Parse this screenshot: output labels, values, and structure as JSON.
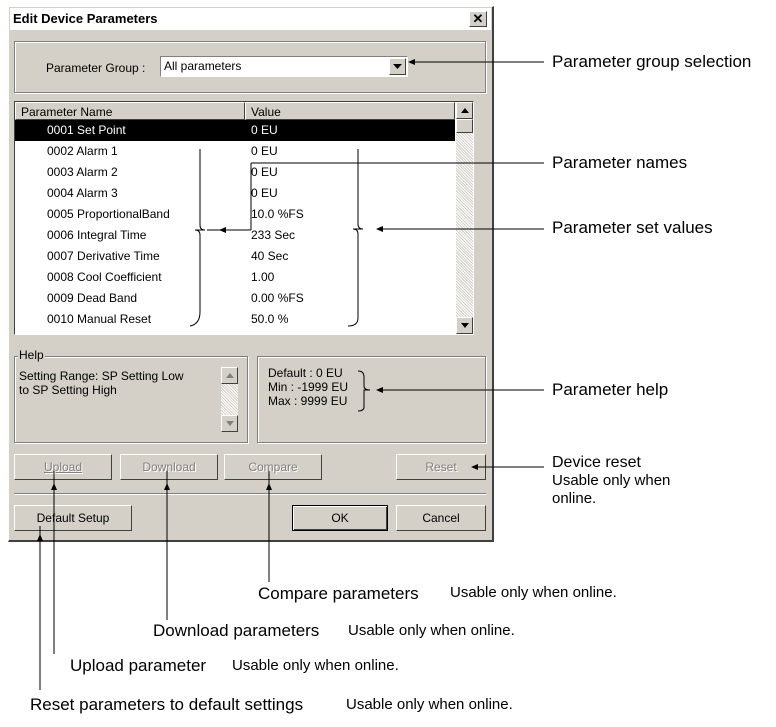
{
  "window": {
    "title": "Edit Device Parameters",
    "close_glyph": "✕"
  },
  "group": {
    "label": "Parameter Group :",
    "selected": "All parameters"
  },
  "table": {
    "headers": [
      "Parameter Name",
      "Value"
    ],
    "rows": [
      {
        "name": "0001 Set Point",
        "value": "0 EU"
      },
      {
        "name": "0002 Alarm 1",
        "value": "0 EU"
      },
      {
        "name": "0003 Alarm 2",
        "value": "0 EU"
      },
      {
        "name": "0004 Alarm 3",
        "value": "0 EU"
      },
      {
        "name": "0005 ProportionalBand",
        "value": "10.0 %FS"
      },
      {
        "name": "0006 Integral Time",
        "value": "233 Sec"
      },
      {
        "name": "0007 Derivative Time",
        "value": "40 Sec"
      },
      {
        "name": "0008 Cool Coefficient",
        "value": "1.00"
      },
      {
        "name": "0009 Dead Band",
        "value": "0.00 %FS"
      },
      {
        "name": "0010 Manual Reset",
        "value": "50.0 %"
      }
    ],
    "selected_row": 0
  },
  "help": {
    "label": "Help",
    "text_line1": "Setting Range: SP Setting Low",
    "text_line2": "to SP Setting High",
    "default": "Default : 0 EU",
    "min": "Min : -1999 EU",
    "max": "Max : 9999 EU"
  },
  "buttons": {
    "upload": "Upload",
    "download": "Download",
    "compare": "Compare",
    "reset": "Reset",
    "default_setup": "Default Setup",
    "ok": "OK",
    "cancel": "Cancel"
  },
  "annotations": {
    "group_selection": "Parameter group selection",
    "names": "Parameter names",
    "set_values": "Parameter set values",
    "help": "Parameter help",
    "device_reset": "Device reset",
    "device_reset_note1": "Usable only when",
    "device_reset_note2": "online.",
    "compare": "Compare parameters",
    "download": "Download parameters",
    "upload": "Upload parameter",
    "reset_default": "Reset parameters to default settings",
    "online_note": "Usable only when online."
  }
}
